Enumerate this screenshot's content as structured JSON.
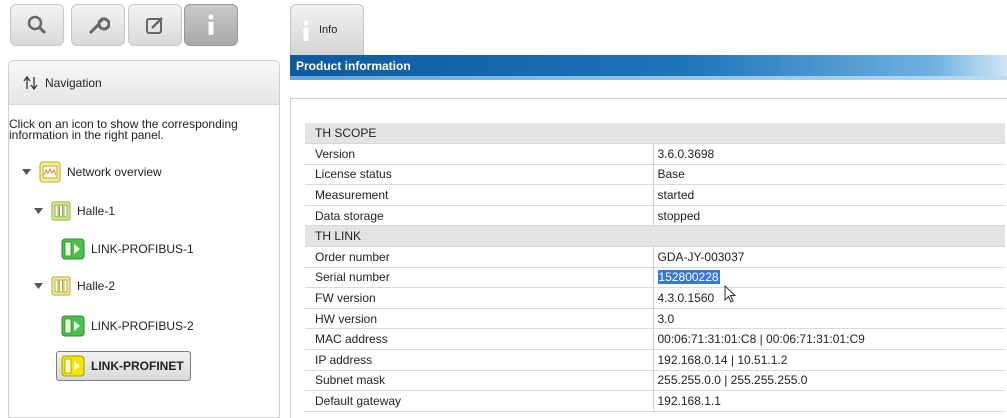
{
  "toolbar": {
    "buttons": [
      {
        "icon": "search-icon"
      },
      {
        "icon": "wrench-icon"
      },
      {
        "icon": "edit-icon"
      },
      {
        "icon": "info-icon",
        "active": true
      }
    ]
  },
  "navigation": {
    "title": "Navigation",
    "help_line1": "Click on an icon to show the corresponding",
    "help_line2": "information in the right panel.",
    "tree": [
      {
        "label": "Network overview",
        "icon": "network-icon",
        "expanded": true
      },
      {
        "label": "Halle-1",
        "icon": "rack-icon",
        "expanded": true
      },
      {
        "label": "LINK-PROFIBUS-1",
        "icon": "device-green-icon"
      },
      {
        "label": "Halle-2",
        "icon": "rack-icon",
        "expanded": true
      },
      {
        "label": "LINK-PROFIBUS-2",
        "icon": "device-green-icon"
      },
      {
        "label": "LINK-PROFINET",
        "icon": "device-yellow-icon",
        "selected": true
      }
    ]
  },
  "tab": {
    "label": "Info"
  },
  "panel": {
    "title": "Product information"
  },
  "table": {
    "section1": "TH SCOPE",
    "rows1": [
      {
        "key": "Version",
        "value": "3.6.0.3698"
      },
      {
        "key": "License status",
        "value": "Base"
      },
      {
        "key": "Measurement",
        "value": "started"
      },
      {
        "key": "Data storage",
        "value": "stopped"
      }
    ],
    "section2": "TH LINK",
    "rows2": [
      {
        "key": "Order number",
        "value": "GDA-JY-003037"
      },
      {
        "key": "Serial number",
        "value": "152800228",
        "selected": true
      },
      {
        "key": "FW version",
        "value": "4.3.0.1560"
      },
      {
        "key": "HW version",
        "value": "3.0"
      },
      {
        "key": "MAC address",
        "value": "00:06:71:31:01:C8 | 00:06:71:31:01:C9"
      },
      {
        "key": "IP address",
        "value": "192.168.0.14 | 10.51.1.2"
      },
      {
        "key": "Subnet mask",
        "value": "255.255.0.0 | 255.255.255.0"
      },
      {
        "key": "Default gateway",
        "value": "192.168.1.1"
      }
    ]
  },
  "colors": {
    "title_bar": "#0d5a9e",
    "selection": "#3478d9",
    "section_bg": "#e3e3e3",
    "device_green": "#3cb43c",
    "device_yellow": "#f2e600"
  }
}
